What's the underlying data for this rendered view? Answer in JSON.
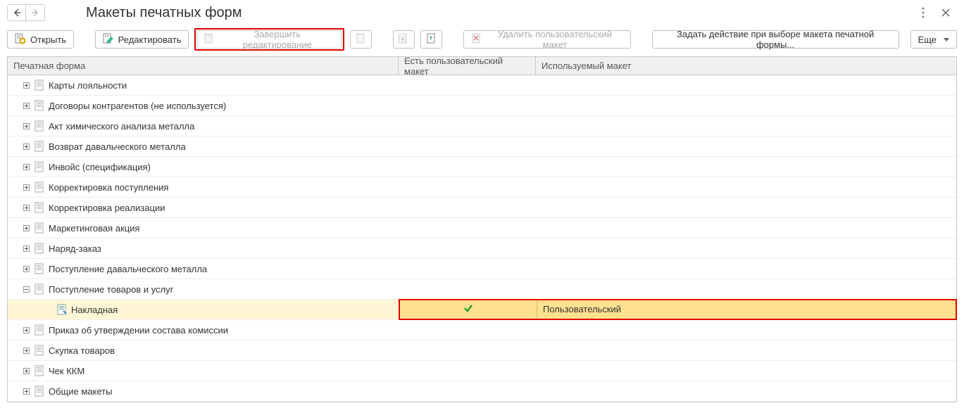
{
  "header": {
    "title": "Макеты печатных форм"
  },
  "toolbar": {
    "open": "Открыть",
    "edit": "Редактировать",
    "finish_edit": "Завершить редактирование",
    "delete_user_template": "Удалить пользовательский макет",
    "set_action": "Задать действие при выборе макета печатной формы...",
    "more": "Еще"
  },
  "columns": {
    "c1": "Печатная форма",
    "c2": "Есть пользовательский макет",
    "c3": "Используемый макет"
  },
  "rows": [
    {
      "label": "Карты лояльности",
      "exp": "plus"
    },
    {
      "label": "Договоры контрагентов (не используется)",
      "exp": "plus"
    },
    {
      "label": "Акт химического анализа металла",
      "exp": "plus"
    },
    {
      "label": "Возврат давальческого металла",
      "exp": "plus"
    },
    {
      "label": "Инвойс (спецификация)",
      "exp": "plus"
    },
    {
      "label": "Корректировка поступления",
      "exp": "plus"
    },
    {
      "label": "Корректировка реализации",
      "exp": "plus"
    },
    {
      "label": "Маркетинговая акция",
      "exp": "plus"
    },
    {
      "label": "Наряд-заказ",
      "exp": "plus"
    },
    {
      "label": "Поступление давальческого металла",
      "exp": "plus"
    },
    {
      "label": "Поступление товаров и услуг",
      "exp": "minus"
    },
    {
      "label": "Накладная",
      "child": true,
      "selected": true,
      "has_user": true,
      "used": "Пользовательский"
    },
    {
      "label": "Приказ об утверждении состава комиссии",
      "exp": "plus"
    },
    {
      "label": "Скупка товаров",
      "exp": "plus"
    },
    {
      "label": "Чек ККМ",
      "exp": "plus"
    },
    {
      "label": "Общие макеты",
      "exp": "plus"
    }
  ]
}
